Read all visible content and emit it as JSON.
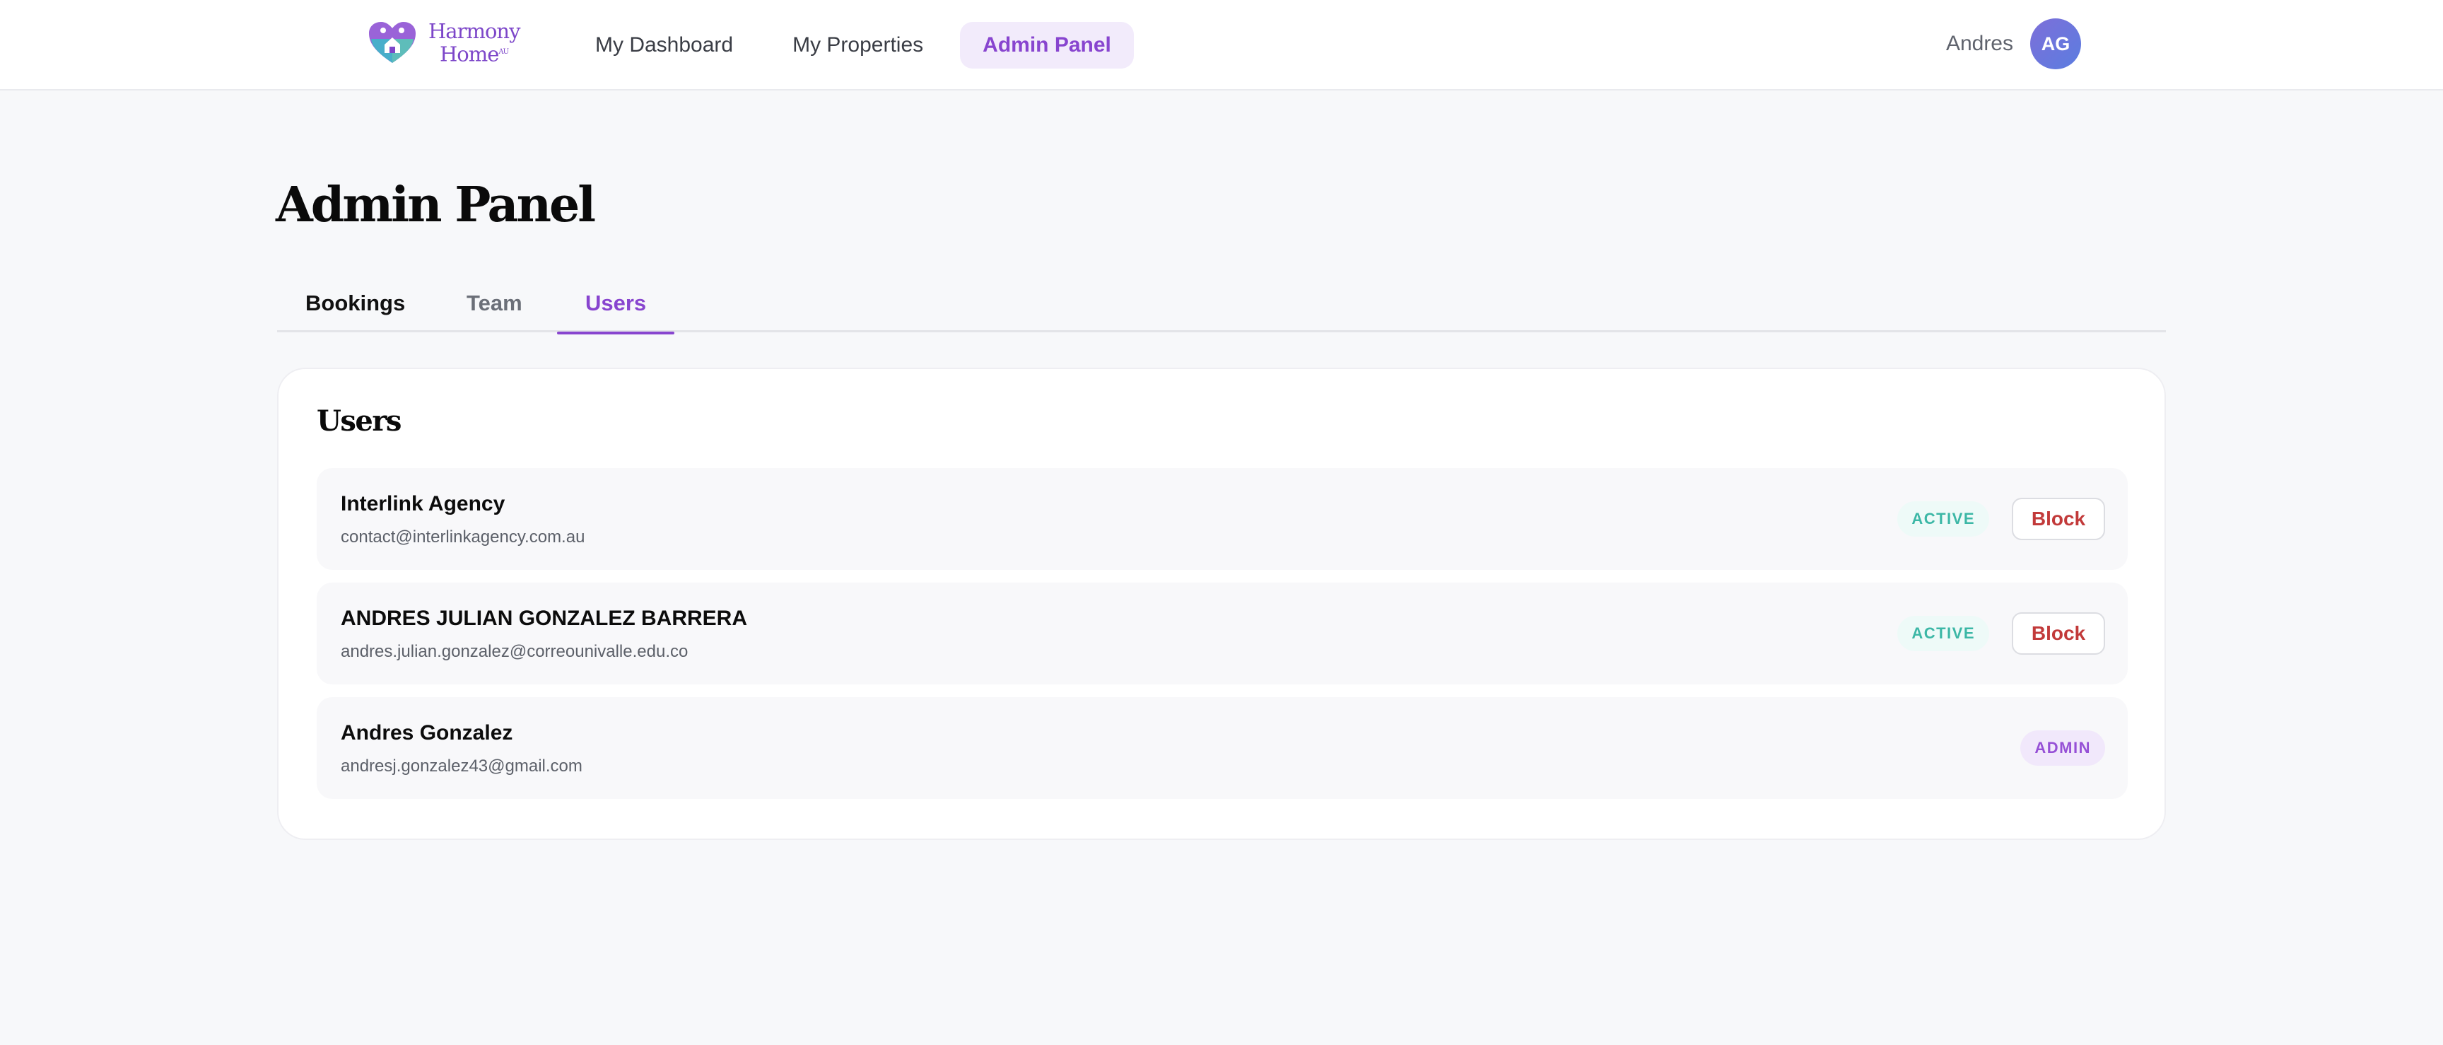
{
  "brand": {
    "line1": "Harmony",
    "line2": "Home",
    "suffix": "AU"
  },
  "nav": {
    "items": [
      {
        "label": "My Dashboard"
      },
      {
        "label": "My Properties"
      },
      {
        "label": "Admin Panel"
      }
    ],
    "active_index": 2
  },
  "user": {
    "name": "Andres",
    "initials": "AG"
  },
  "page": {
    "title": "Admin Panel"
  },
  "tabs": {
    "items": [
      {
        "label": "Bookings"
      },
      {
        "label": "Team"
      },
      {
        "label": "Users"
      }
    ],
    "active_index": 2
  },
  "users_card": {
    "title": "Users",
    "rows": [
      {
        "name": "Interlink Agency",
        "email": "contact@interlinkagency.com.au",
        "status": "ACTIVE",
        "action": "Block"
      },
      {
        "name": "ANDRES JULIAN GONZALEZ BARRERA",
        "email": "andres.julian.gonzalez@correounivalle.edu.co",
        "status": "ACTIVE",
        "action": "Block"
      },
      {
        "name": "Andres Gonzalez",
        "email": "andresj.gonzalez43@gmail.com",
        "status": "ADMIN"
      }
    ]
  },
  "colors": {
    "accent": "#8845cf",
    "active_badge": "#3cb7a6",
    "admin_badge": "#9650d6",
    "block_text": "#c23a3a",
    "page_bg": "#f7f8fa"
  }
}
